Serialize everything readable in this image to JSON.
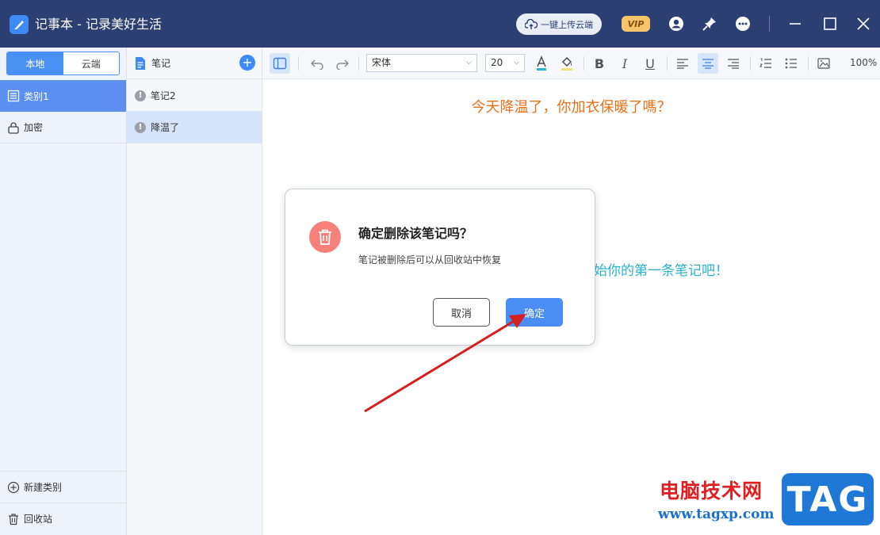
{
  "window": {
    "title": "记事本 - 记录美好生活",
    "upload_label": "一键上传云端",
    "vip_label": "VIP"
  },
  "sidebar": {
    "tabs": [
      {
        "label": "本地",
        "active": true
      },
      {
        "label": "云端",
        "active": false
      }
    ],
    "categories": [
      {
        "label": "类别1",
        "selected": true
      },
      {
        "label": "加密",
        "selected": false
      }
    ],
    "new_category_label": "新建类别",
    "recycle_label": "回收站"
  },
  "notes": {
    "header_label": "笔记",
    "items": [
      {
        "label": "笔记2",
        "selected": false
      },
      {
        "label": "降温了",
        "selected": true
      }
    ]
  },
  "toolbar": {
    "font_family": "宋体",
    "font_size": "20",
    "zoom": "100%"
  },
  "editor": {
    "heading": "今天降温了，你加衣保暖了嗎？",
    "hint": "始你的第一条笔记吧！"
  },
  "dialog": {
    "title": "确定删除该笔记吗？",
    "description": "笔记被删除后可以从回收站中恢复",
    "cancel_label": "取消",
    "confirm_label": "确定"
  },
  "watermark": {
    "site_name": "电脑技术网",
    "url": "www.tagxp.com",
    "tag": "TAG"
  },
  "colors": {
    "titlebar": "#2b3f72",
    "accent": "#4a8ef5",
    "heading_text": "#e8711a",
    "hint_text": "#2ab3d1",
    "delete_icon_bg": "#f5817a",
    "annotation_arrow": "#d42020"
  }
}
